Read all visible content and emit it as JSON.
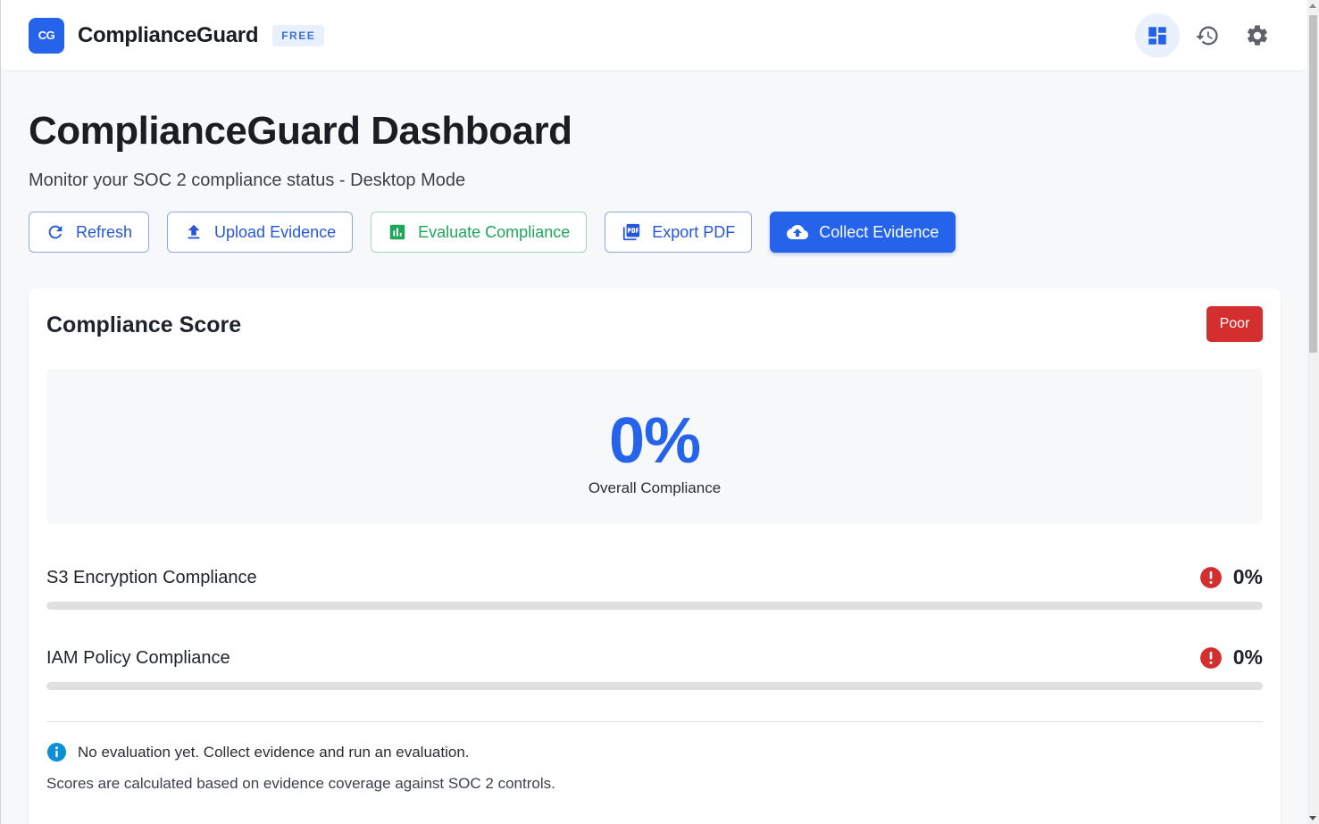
{
  "header": {
    "logo_text": "CG",
    "brand": "ComplianceGuard",
    "plan_badge": "FREE",
    "icons": [
      "dashboard-icon",
      "history-icon",
      "gear-icon"
    ]
  },
  "page": {
    "title": "ComplianceGuard Dashboard",
    "subtitle": "Monitor your SOC 2 compliance status - Desktop Mode"
  },
  "actions": {
    "refresh": "Refresh",
    "upload": "Upload Evidence",
    "evaluate": "Evaluate Compliance",
    "export": "Export PDF",
    "collect": "Collect Evidence"
  },
  "score_card": {
    "title": "Compliance Score",
    "status": "Poor",
    "overall_value": "0%",
    "overall_label": "Overall Compliance",
    "metrics": [
      {
        "label": "S3 Encryption Compliance",
        "value": "0%",
        "progress": 0
      },
      {
        "label": "IAM Policy Compliance",
        "value": "0%",
        "progress": 0
      }
    ],
    "info": "No evaluation yet. Collect evidence and run an evaluation.",
    "footnote": "Scores are calculated based on evidence coverage against SOC 2 controls."
  },
  "colors": {
    "primary": "#2563eb",
    "success": "#1fa55a",
    "danger": "#d32f2f",
    "info": "#0b8fd6"
  }
}
